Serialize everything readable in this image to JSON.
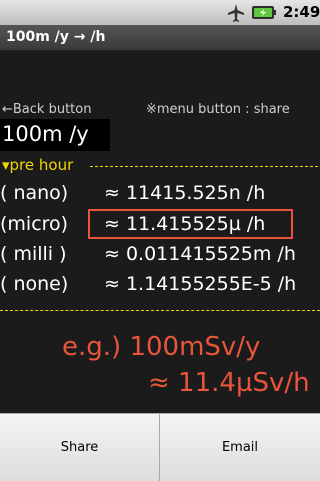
{
  "status_bar": {
    "time": "2:49",
    "icons": [
      "airplane-icon",
      "battery-icon"
    ]
  },
  "title_bar": {
    "title": "100m /y → /h"
  },
  "hints": {
    "back": "←Back button",
    "menu": "※menu button : share"
  },
  "input": {
    "value": "100m /y"
  },
  "section": {
    "label": "▾pre hour"
  },
  "rows": [
    {
      "label": "( nano)",
      "value": "≈ 11415.525n /h"
    },
    {
      "label": "(micro)",
      "value": "≈ 11.415525µ /h"
    },
    {
      "label": "(  milli )",
      "value": "≈ 0.011415525m /h"
    },
    {
      "label": "( none)",
      "value": "≈ 1.14155255E-5 /h"
    }
  ],
  "example": {
    "line1": "e.g.) 100mSv/y",
    "line2": "≈ 11.4µSv/h"
  },
  "buttons": {
    "share": "Share",
    "email": "Email"
  },
  "colors": {
    "accent": "#f1d600",
    "highlight": "#e8553a",
    "background": "#1b1b1b"
  }
}
